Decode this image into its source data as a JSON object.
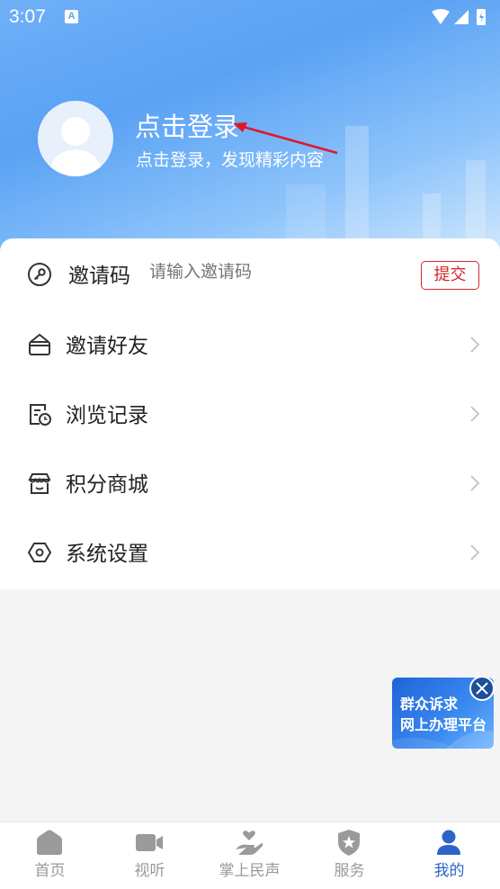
{
  "status_bar": {
    "time": "3:07",
    "notification_icon": "A"
  },
  "profile": {
    "login_title": "点击登录",
    "login_subtitle": "点击登录，发现精彩内容"
  },
  "invite": {
    "label": "邀请码",
    "placeholder": "请输入邀请码",
    "submit_label": "提交"
  },
  "menu": [
    {
      "label": "邀请好友",
      "icon": "envelope-icon"
    },
    {
      "label": "浏览记录",
      "icon": "history-icon"
    },
    {
      "label": "积分商城",
      "icon": "store-icon"
    },
    {
      "label": "系统设置",
      "icon": "settings-hexagon-icon"
    }
  ],
  "banner": {
    "line1": "群众诉求",
    "line2": "网上办理平台"
  },
  "bottom_nav": [
    {
      "label": "首页",
      "icon": "home-icon"
    },
    {
      "label": "视听",
      "icon": "video-icon"
    },
    {
      "label": "掌上民声",
      "icon": "heart-hand-icon"
    },
    {
      "label": "服务",
      "icon": "shield-star-icon"
    },
    {
      "label": "我的",
      "icon": "user-icon",
      "active": true
    }
  ],
  "colors": {
    "accent": "#2d63c8",
    "submit": "#d6262b",
    "header": "#5aa2f4"
  }
}
